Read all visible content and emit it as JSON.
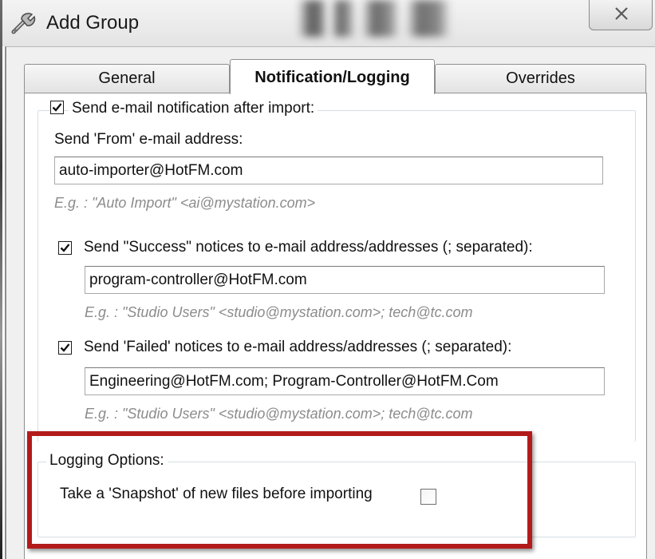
{
  "window": {
    "title": "Add Group",
    "close_glyph": "✕",
    "title_icon": "wrench-icon"
  },
  "tabs": [
    {
      "label": "General",
      "active": false
    },
    {
      "label": "Notification/Logging",
      "active": true
    },
    {
      "label": "Overrides",
      "active": false
    }
  ],
  "email_group": {
    "legend": "Send e-mail notification after import:",
    "enabled": true,
    "from_label": "Send 'From' e-mail address:",
    "from_value": "auto-importer@HotFM.com",
    "from_hint": "E.g. : \"Auto Import\" <ai@mystation.com>",
    "success": {
      "label": "Send \"Success\" notices to e-mail address/addresses (; separated):",
      "checked": true,
      "value": "program-controller@HotFM.com",
      "hint": "E.g. : \"Studio Users\" <studio@mystation.com>; tech@tc.com"
    },
    "failed": {
      "label": "Send 'Failed' notices to e-mail address/addresses (; separated):",
      "checked": true,
      "value": "Engineering@HotFM.com; Program-Controller@HotFM.Com",
      "hint": "E.g. : \"Studio Users\" <studio@mystation.com>; tech@tc.com"
    }
  },
  "logging_group": {
    "legend": "Logging Options:",
    "snapshot_label": "Take a 'Snapshot' of new files before importing",
    "snapshot_checked": false
  },
  "colors": {
    "highlight": "#b31b1b",
    "hint_text": "#8c8c8c",
    "panel": "#ffffff",
    "dialog": "#f0f0f0"
  }
}
